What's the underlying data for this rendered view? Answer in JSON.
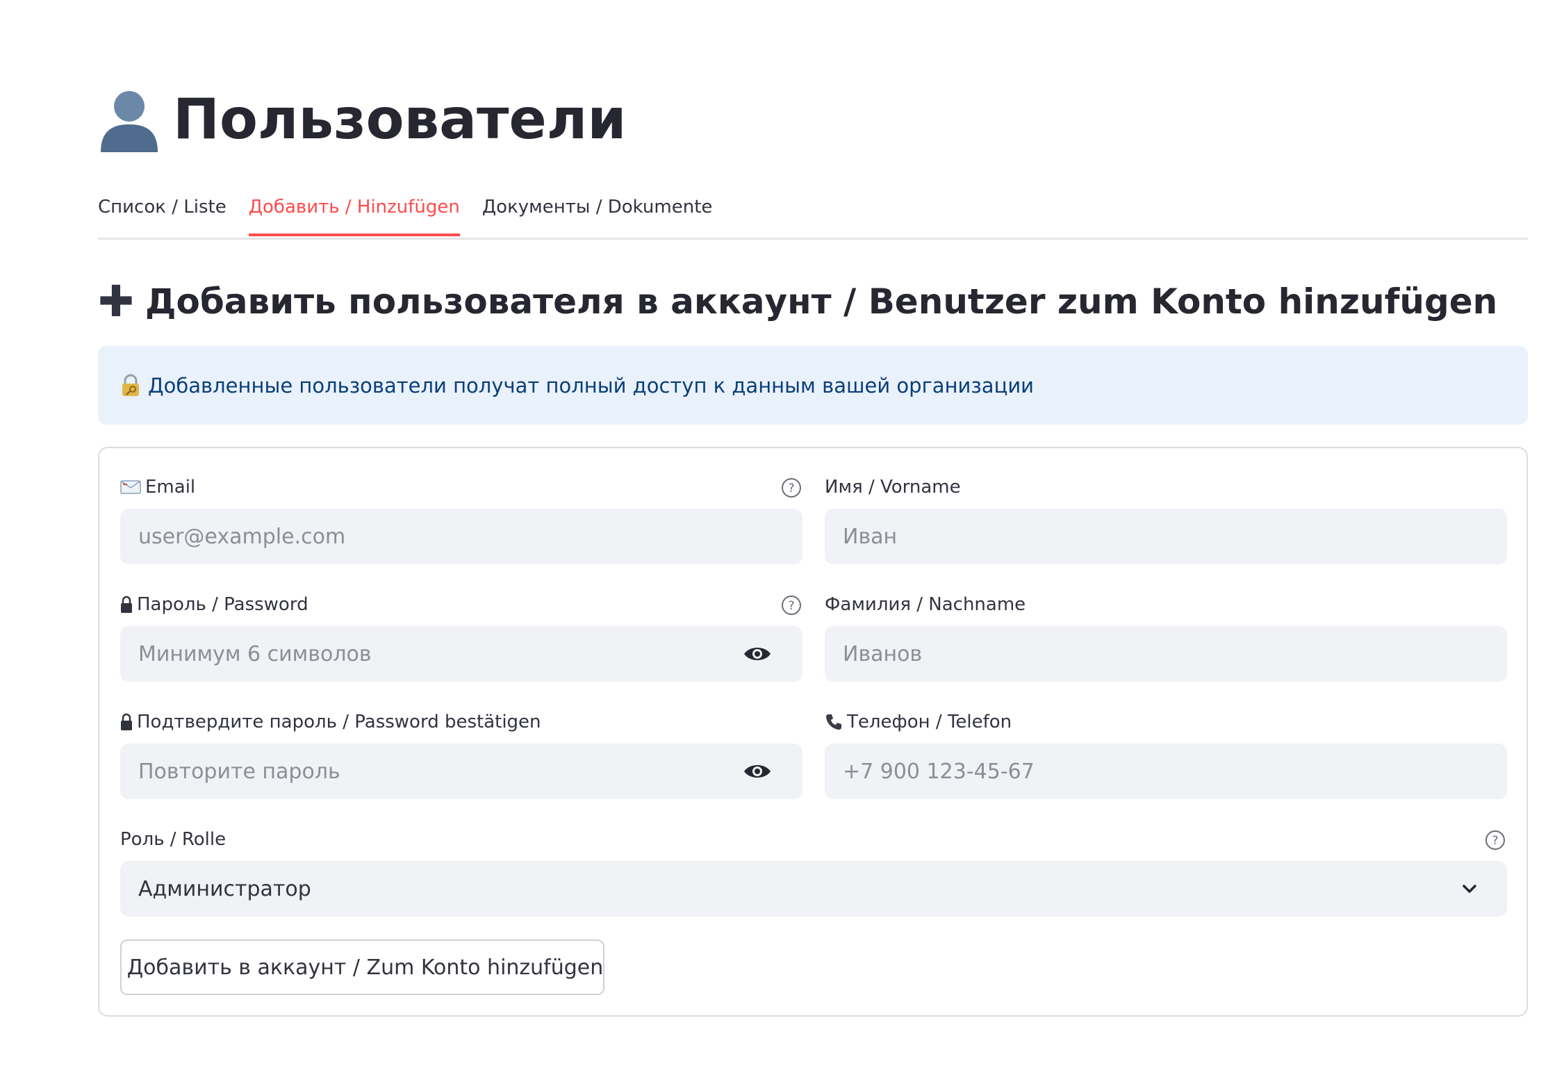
{
  "page": {
    "title": "Пользователи",
    "title_icon": "user-silhouette-icon"
  },
  "tabs": [
    {
      "label": "Список / Liste",
      "active": false
    },
    {
      "label": "Добавить / Hinzufügen",
      "active": true
    },
    {
      "label": "Документы / Dokumente",
      "active": false
    }
  ],
  "section": {
    "icon": "plus-icon",
    "title": "Добавить пользователя в аккаунт / Benutzer zum Konto hinzufügen"
  },
  "info": {
    "icon": "lock-key-icon",
    "text": "Добавленные пользователи получат полный доступ к данным вашей организации"
  },
  "form": {
    "email": {
      "icon": "envelope-icon",
      "label": "Email",
      "placeholder": "user@example.com",
      "has_help": true
    },
    "first_name": {
      "label": "Имя / Vorname",
      "placeholder": "Иван"
    },
    "password": {
      "icon": "lock-icon",
      "label": "Пароль / Password",
      "placeholder": "Минимум 6 символов",
      "has_help": true
    },
    "last_name": {
      "label": "Фамилия / Nachname",
      "placeholder": "Иванов"
    },
    "confirm_password": {
      "icon": "lock-icon",
      "label": "Подтвердите пароль / Password bestätigen",
      "placeholder": "Повторите пароль"
    },
    "phone": {
      "icon": "phone-icon",
      "label": "Телефон / Telefon",
      "placeholder": "+7 900 123-45-67"
    },
    "role": {
      "label": "Роль / Rolle",
      "selected": "Администратор",
      "has_help": true
    },
    "submit": {
      "icon": "users-icon",
      "label": "Добавить в аккаунт / Zum Konto hinzufügen"
    }
  },
  "colors": {
    "accent": "#ff4b4b",
    "info_bg": "#e9f1fb",
    "info_text": "#0b3e7a",
    "input_bg": "#f0f2f6",
    "text": "#31333f"
  }
}
